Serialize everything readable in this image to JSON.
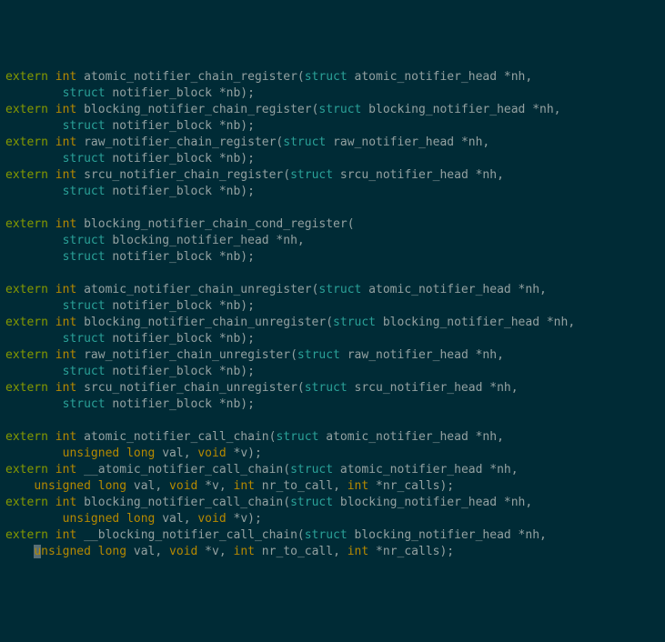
{
  "kw": {
    "extern": "extern",
    "int": "int",
    "struct": "struct",
    "unsigned": "unsigned",
    "long": "long",
    "void": "void"
  },
  "line1": " atomic_notifier_chain_register(",
  "line1b": " atomic_notifier_head *nh,",
  "line2": " notifier_block *nb);",
  "line3": " blocking_notifier_chain_register(",
  "line3b": " blocking_notifier_head *nh,",
  "line5": " raw_notifier_chain_register(",
  "line5b": " raw_notifier_head *nh,",
  "line7": " srcu_notifier_chain_register(",
  "line7b": " srcu_notifier_head *nh,",
  "line10": " blocking_notifier_chain_cond_register(",
  "line11": " blocking_notifier_head *nh,",
  "line14": " atomic_notifier_chain_unregister(",
  "line14b": " atomic_notifier_head *nh,",
  "line16": " blocking_notifier_chain_unregister(",
  "line16b": " blocking_notifier_head *nh,",
  "line18": " raw_notifier_chain_unregister(",
  "line18b": " raw_notifier_head *nh,",
  "line20": " srcu_notifier_chain_unregister(",
  "line20b": " srcu_notifier_head *nh,",
  "line23": " atomic_notifier_call_chain(",
  "line23b": " atomic_notifier_head *nh,",
  "valv": " val, ",
  "starv": " *v);",
  "line25": " __atomic_notifier_call_chain(",
  "starv2": " *v, ",
  "nrto": " nr_to_call, ",
  "nrcalls": " *nr_calls);",
  "line27": " blocking_notifier_call_chain(",
  "line29": " __blocking_notifier_call_chain(",
  "cursor_u": "u",
  "nsigned_tail": "nsigned"
}
